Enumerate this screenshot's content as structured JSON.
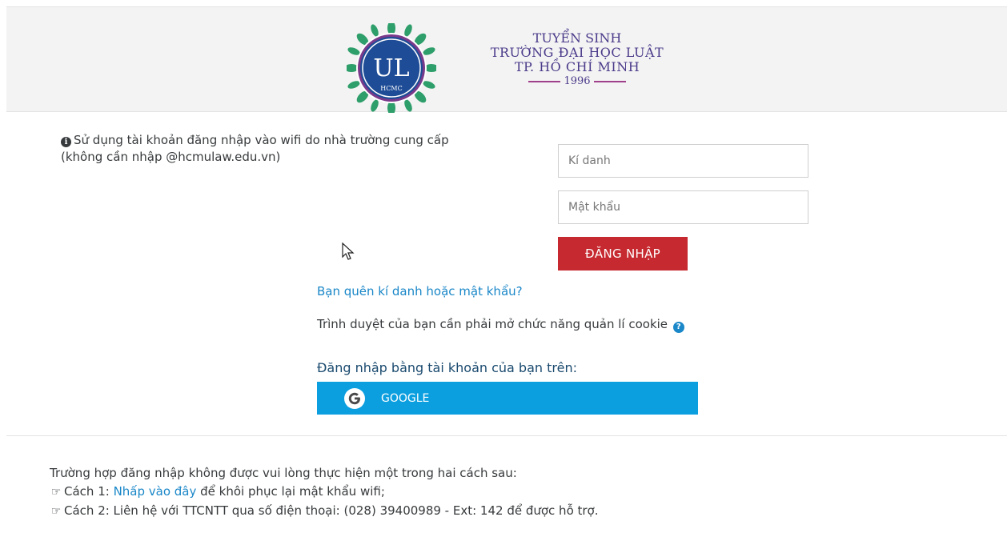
{
  "header": {
    "logo": {
      "emblem_letters": "UL",
      "emblem_city": "HCMC",
      "line1": "TUYỂN SINH",
      "line2": "TRƯỜNG ĐẠI HỌC LUẬT",
      "line3": "TP. HỒ CHÍ MINH",
      "year": "1996"
    }
  },
  "login": {
    "info_icon": "info-circle-icon",
    "info_line1": "Sử dụng tài khoản đăng nhập vào wifi do nhà trường cung cấp",
    "info_line2": "(không cần nhập @hcmulaw.edu.vn)",
    "username_placeholder": "Kí danh",
    "password_placeholder": "Mật khẩu",
    "login_button": "ĐĂNG NHẬP",
    "forgot_link": "Bạn quên kí danh hoặc mật khẩu?",
    "cookie_note": "Trình duyệt của bạn cần phải mở chức năng quản lí cookie",
    "oauth_title": "Đăng nhập bằng tài khoản của bạn trên:",
    "google_button": "GOOGLE"
  },
  "footer": {
    "intro": "Trường hợp đăng nhập không được vui lòng thực hiện một trong hai cách sau:",
    "way1_prefix": "Cách 1: ",
    "way1_link": "Nhấp vào đây",
    "way1_suffix": " để khôi phục lại mật khẩu wifi;",
    "way2": "Cách 2: Liên hệ với TTCNTT qua số điện thoại: (028) 39400989 - Ext: 142 để được hỗ trợ."
  },
  "colors": {
    "brand_purple": "#4b3a8a",
    "login_red": "#c6292f",
    "google_blue": "#0b9fe0",
    "link_blue": "#1a87c8"
  }
}
